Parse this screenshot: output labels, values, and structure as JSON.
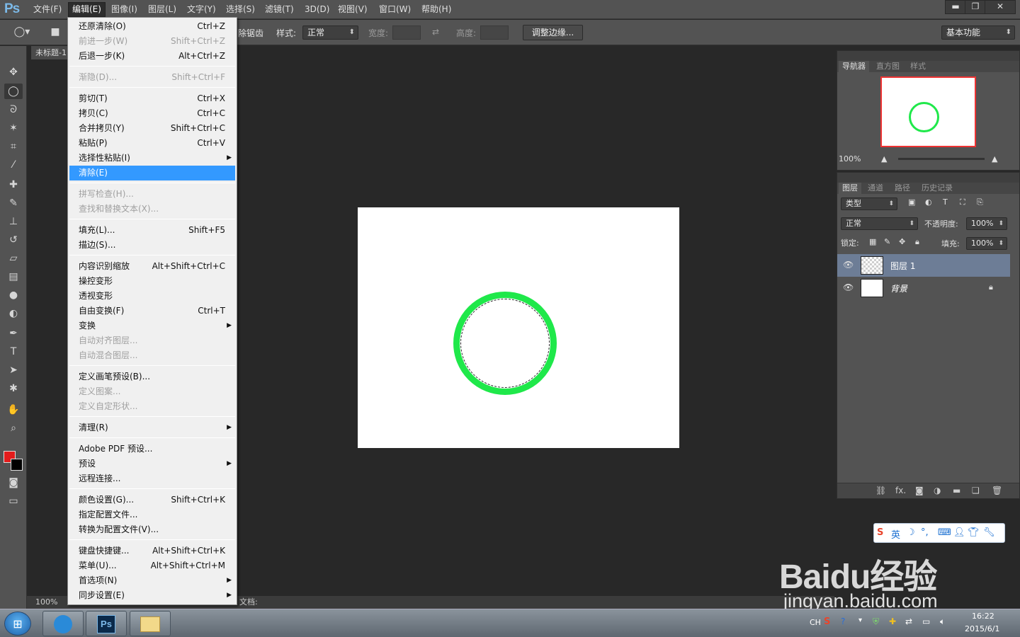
{
  "app": {
    "logo": "Ps"
  },
  "menubar": {
    "items": [
      "文件(F)",
      "编辑(E)",
      "图像(I)",
      "图层(L)",
      "文字(Y)",
      "选择(S)",
      "滤镜(T)",
      "3D(D)",
      "视图(V)",
      "窗口(W)",
      "帮助(H)"
    ],
    "active": "编辑(E)"
  },
  "window_controls": {
    "minimize": "▬",
    "restore": "❐",
    "close": "✕"
  },
  "options_bar": {
    "feather_tail": "除锯齿",
    "style_label": "样式:",
    "style_value": "正常",
    "width_label": "宽度:",
    "height_label": "高度:",
    "refine_edge": "调整边缘...",
    "workspace": "基本功能"
  },
  "document": {
    "tab_title": "未标题-1",
    "zoom": "100%",
    "status_text": "文档:"
  },
  "edit_menu": {
    "items": [
      {
        "label": "还原清除(O)",
        "shortcut": "Ctrl+Z"
      },
      {
        "label": "前进一步(W)",
        "shortcut": "Shift+Ctrl+Z"
      },
      {
        "label": "后退一步(K)",
        "shortcut": "Alt+Ctrl+Z"
      },
      {
        "label": "渐隐(D)...",
        "shortcut": "Shift+Ctrl+F"
      },
      {
        "label": "剪切(T)",
        "shortcut": "Ctrl+X"
      },
      {
        "label": "拷贝(C)",
        "shortcut": "Ctrl+C"
      },
      {
        "label": "合并拷贝(Y)",
        "shortcut": "Shift+Ctrl+C"
      },
      {
        "label": "粘贴(P)",
        "shortcut": "Ctrl+V"
      },
      {
        "label": "选择性粘贴(I)",
        "shortcut": ""
      },
      {
        "label": "清除(E)",
        "shortcut": ""
      },
      {
        "label": "拼写检查(H)...",
        "shortcut": ""
      },
      {
        "label": "查找和替换文本(X)...",
        "shortcut": ""
      },
      {
        "label": "填充(L)...",
        "shortcut": "Shift+F5"
      },
      {
        "label": "描边(S)...",
        "shortcut": ""
      },
      {
        "label": "内容识别缩放",
        "shortcut": "Alt+Shift+Ctrl+C"
      },
      {
        "label": "操控变形",
        "shortcut": ""
      },
      {
        "label": "透视变形",
        "shortcut": ""
      },
      {
        "label": "自由变换(F)",
        "shortcut": "Ctrl+T"
      },
      {
        "label": "变换",
        "shortcut": ""
      },
      {
        "label": "自动对齐图层...",
        "shortcut": ""
      },
      {
        "label": "自动混合图层...",
        "shortcut": ""
      },
      {
        "label": "定义画笔预设(B)...",
        "shortcut": ""
      },
      {
        "label": "定义图案...",
        "shortcut": ""
      },
      {
        "label": "定义自定形状...",
        "shortcut": ""
      },
      {
        "label": "清理(R)",
        "shortcut": ""
      },
      {
        "label": "Adobe PDF 预设...",
        "shortcut": ""
      },
      {
        "label": "预设",
        "shortcut": ""
      },
      {
        "label": "远程连接...",
        "shortcut": ""
      },
      {
        "label": "颜色设置(G)...",
        "shortcut": "Shift+Ctrl+K"
      },
      {
        "label": "指定配置文件...",
        "shortcut": ""
      },
      {
        "label": "转换为配置文件(V)...",
        "shortcut": ""
      },
      {
        "label": "键盘快捷键...",
        "shortcut": "Alt+Shift+Ctrl+K"
      },
      {
        "label": "菜单(U)...",
        "shortcut": "Alt+Shift+Ctrl+M"
      },
      {
        "label": "首选项(N)",
        "shortcut": ""
      },
      {
        "label": "同步设置(E)",
        "shortcut": ""
      }
    ],
    "highlighted": "清除(E)"
  },
  "navigator_panel": {
    "tabs": [
      "导航器",
      "直方图",
      "样式"
    ],
    "zoom": "100%"
  },
  "layers_panel": {
    "tabs": [
      "图层",
      "通道",
      "路径",
      "历史记录"
    ],
    "filter": "类型",
    "blend_mode": "正常",
    "opacity_label": "不透明度:",
    "opacity": "100%",
    "lock_label": "锁定:",
    "fill_label": "填充:",
    "fill": "100%",
    "layers": [
      {
        "name": "图层 1",
        "selected": true
      },
      {
        "name": "背景",
        "selected": false
      }
    ],
    "footer_fx": "fx."
  },
  "ime_bar": {
    "lang": "英"
  },
  "taskbar": {
    "lang": "CH",
    "time": "16:22",
    "date": "2015/6/1"
  },
  "watermark": {
    "brand": "Baidu经验",
    "url": "jingyan.baidu.com"
  },
  "colors": {
    "ui_bg": "#535353",
    "canvas_bg": "#282828",
    "ring_green": "#1fe84a",
    "menu_highlight": "#3399ff",
    "foreground_swatch": "#e31c1c",
    "background_swatch": "#000000"
  }
}
